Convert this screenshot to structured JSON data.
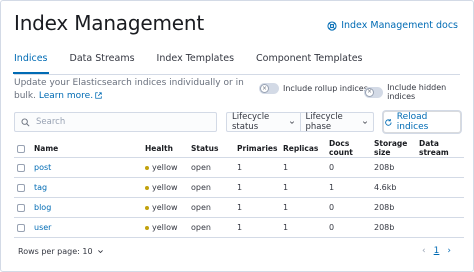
{
  "header": {
    "title": "Index Management",
    "docs_link": "Index Management docs"
  },
  "tabs": [
    {
      "label": "Indices",
      "active": true
    },
    {
      "label": "Data Streams",
      "active": false
    },
    {
      "label": "Index Templates",
      "active": false
    },
    {
      "label": "Component Templates",
      "active": false
    }
  ],
  "description": {
    "text": "Update your Elasticsearch indices individually or in bulk. ",
    "learn_more": "Learn more."
  },
  "toggles": {
    "rollup": "Include rollup indices",
    "hidden": "Include hidden indices"
  },
  "search": {
    "placeholder": "Search"
  },
  "filters": {
    "lifecycle_status": "Lifecycle status",
    "lifecycle_phase": "Lifecycle phase"
  },
  "reload_button": "Reload indices",
  "table": {
    "columns": [
      "Name",
      "Health",
      "Status",
      "Primaries",
      "Replicas",
      "Docs count",
      "Storage size",
      "Data stream"
    ],
    "rows": [
      {
        "name": "post",
        "health": "yellow",
        "status": "open",
        "primaries": "1",
        "replicas": "1",
        "docs": "0",
        "size": "208b",
        "stream": ""
      },
      {
        "name": "tag",
        "health": "yellow",
        "status": "open",
        "primaries": "1",
        "replicas": "1",
        "docs": "1",
        "size": "4.6kb",
        "stream": ""
      },
      {
        "name": "blog",
        "health": "yellow",
        "status": "open",
        "primaries": "1",
        "replicas": "1",
        "docs": "0",
        "size": "208b",
        "stream": ""
      },
      {
        "name": "user",
        "health": "yellow",
        "status": "open",
        "primaries": "1",
        "replicas": "1",
        "docs": "0",
        "size": "208b",
        "stream": ""
      }
    ]
  },
  "pagination": {
    "rows_per_page": "Rows per page: 10",
    "current_page": "1"
  },
  "colors": {
    "accent": "#006bb4",
    "health_yellow": "#c2a20d"
  }
}
